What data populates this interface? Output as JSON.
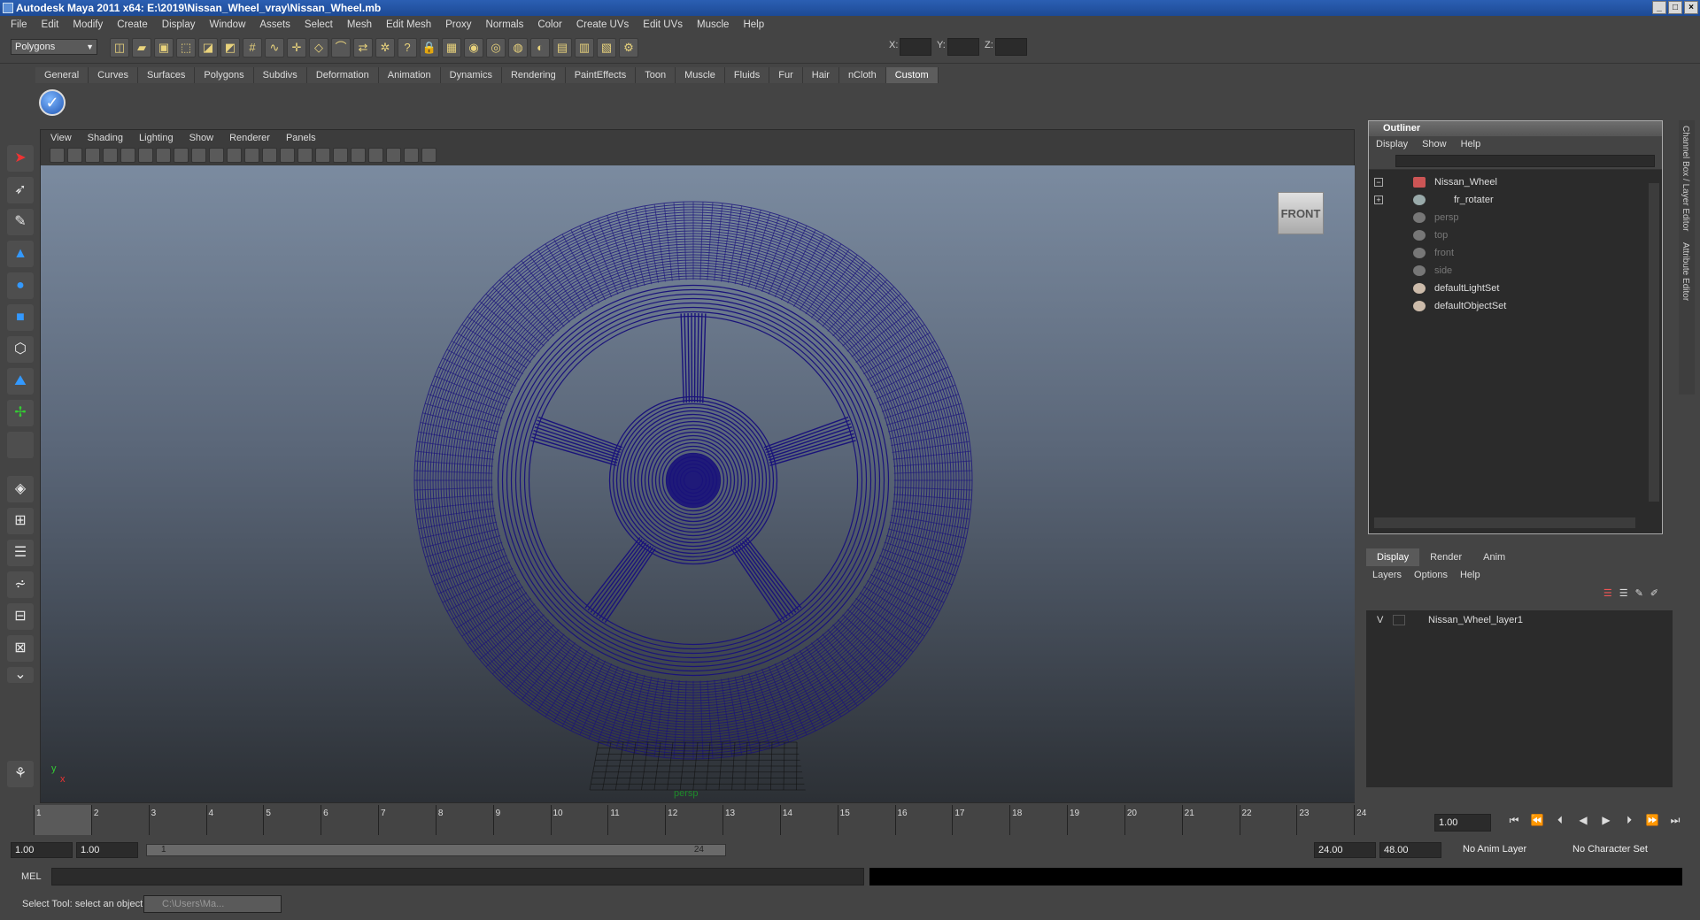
{
  "window": {
    "title": "Autodesk Maya 2011 x64: E:\\2019\\Nissan_Wheel_vray\\Nissan_Wheel.mb"
  },
  "menubar": [
    "File",
    "Edit",
    "Modify",
    "Create",
    "Display",
    "Window",
    "Assets",
    "Select",
    "Mesh",
    "Edit Mesh",
    "Proxy",
    "Normals",
    "Color",
    "Create UVs",
    "Edit UVs",
    "Muscle",
    "Help"
  ],
  "statusline": {
    "mode": "Polygons",
    "x_label": "X:",
    "y_label": "Y:",
    "z_label": "Z:"
  },
  "shelf_tabs": [
    "General",
    "Curves",
    "Surfaces",
    "Polygons",
    "Subdivs",
    "Deformation",
    "Animation",
    "Dynamics",
    "Rendering",
    "PaintEffects",
    "Toon",
    "Muscle",
    "Fluids",
    "Fur",
    "Hair",
    "nCloth",
    "Custom"
  ],
  "shelf_active": "Custom",
  "viewport": {
    "menu": [
      "View",
      "Shading",
      "Lighting",
      "Show",
      "Renderer",
      "Panels"
    ],
    "viewcube_label": "FRONT",
    "camera_label": "persp",
    "axis_y": "y",
    "axis_x": "x",
    "wire_color": "#1a137a"
  },
  "outliner": {
    "title": "Outliner",
    "menu": [
      "Display",
      "Show",
      "Help"
    ],
    "items": [
      {
        "label": "Nissan_Wheel",
        "dim": false
      },
      {
        "label": "fr_rotater",
        "dim": false
      },
      {
        "label": "persp",
        "dim": true
      },
      {
        "label": "top",
        "dim": true
      },
      {
        "label": "front",
        "dim": true
      },
      {
        "label": "side",
        "dim": true
      },
      {
        "label": "defaultLightSet",
        "dim": false
      },
      {
        "label": "defaultObjectSet",
        "dim": false
      }
    ]
  },
  "layer_editor": {
    "tabs": [
      "Display",
      "Render",
      "Anim"
    ],
    "menu": [
      "Layers",
      "Options",
      "Help"
    ],
    "layer": {
      "visible": "V",
      "name": "Nissan_Wheel_layer1"
    }
  },
  "right_tabs": [
    "Channel Box / Layer Editor",
    "Attribute Editor"
  ],
  "timeline": {
    "frames": [
      "1",
      "2",
      "3",
      "4",
      "5",
      "6",
      "7",
      "8",
      "9",
      "10",
      "11",
      "12",
      "13",
      "14",
      "15",
      "16",
      "17",
      "18",
      "19",
      "20",
      "21",
      "22",
      "23",
      "24"
    ],
    "current_frame": "1",
    "current_field": "1.00"
  },
  "range": {
    "start": "1.00",
    "playback_start": "1.00",
    "slider_start": "1",
    "slider_end": "24",
    "playback_end": "24.00",
    "end": "48.00",
    "anim_layer": "No Anim Layer",
    "char_set": "No Character Set"
  },
  "cmdline": {
    "label": "MEL"
  },
  "helpline": {
    "text": "Select Tool: select an object",
    "task": "C:\\Users\\Ma..."
  }
}
